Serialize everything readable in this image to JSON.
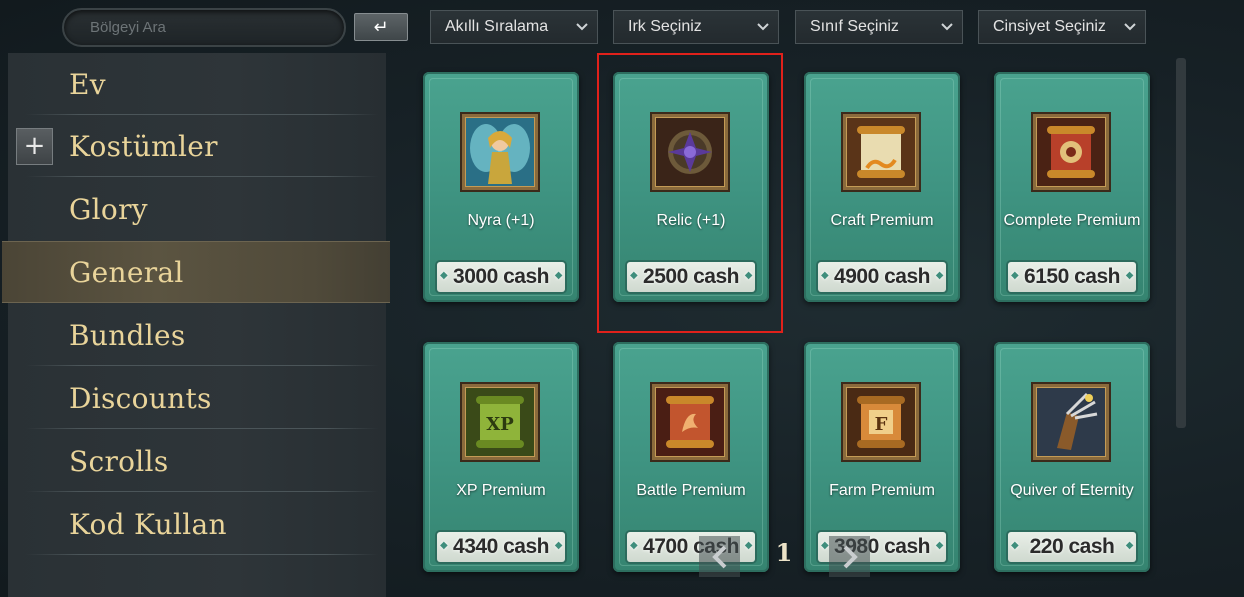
{
  "search": {
    "placeholder": "Bölgeyi Ara",
    "enter_icon": "enter-return-icon"
  },
  "filters": [
    {
      "label": "Akıllı Sıralama"
    },
    {
      "label": "Irk Seçiniz"
    },
    {
      "label": "Sınıf Seçiniz"
    },
    {
      "label": "Cinsiyet Seçiniz"
    }
  ],
  "sidebar": {
    "items": [
      {
        "label": "Ev"
      },
      {
        "label": "Kostümler",
        "expand_icon": "plus-icon"
      },
      {
        "label": "Glory"
      },
      {
        "label": "General",
        "active": true
      },
      {
        "label": "Bundles"
      },
      {
        "label": "Discounts"
      },
      {
        "label": "Scrolls"
      },
      {
        "label": "Kod Kullan"
      }
    ]
  },
  "items": [
    {
      "name": "Nyra (+1)",
      "price": "3000 cash",
      "icon": "fairy-portrait-icon"
    },
    {
      "name": "Relic (+1)",
      "price": "2500 cash",
      "icon": "relic-star-icon",
      "selected": true
    },
    {
      "name": "Craft Premium",
      "price": "4900 cash",
      "icon": "craft-scroll-icon"
    },
    {
      "name": "Complete Premium",
      "price": "6150 cash",
      "icon": "complete-scroll-icon"
    },
    {
      "name": "XP Premium",
      "price": "4340 cash",
      "icon": "xp-scroll-icon",
      "badge": "XP"
    },
    {
      "name": "Battle Premium",
      "price": "4700 cash",
      "icon": "battle-scroll-icon"
    },
    {
      "name": "Farm Premium",
      "price": "3980 cash",
      "icon": "farm-scroll-icon",
      "badge": "F"
    },
    {
      "name": "Quiver of Eternity",
      "price": "220 cash",
      "icon": "quiver-arrows-icon"
    }
  ],
  "pagination": {
    "current_page": "1"
  },
  "colors": {
    "card": "#3f9482",
    "nav_text": "#e9d49a",
    "selection": "#e0211b",
    "active_nav": "#5b5441"
  }
}
